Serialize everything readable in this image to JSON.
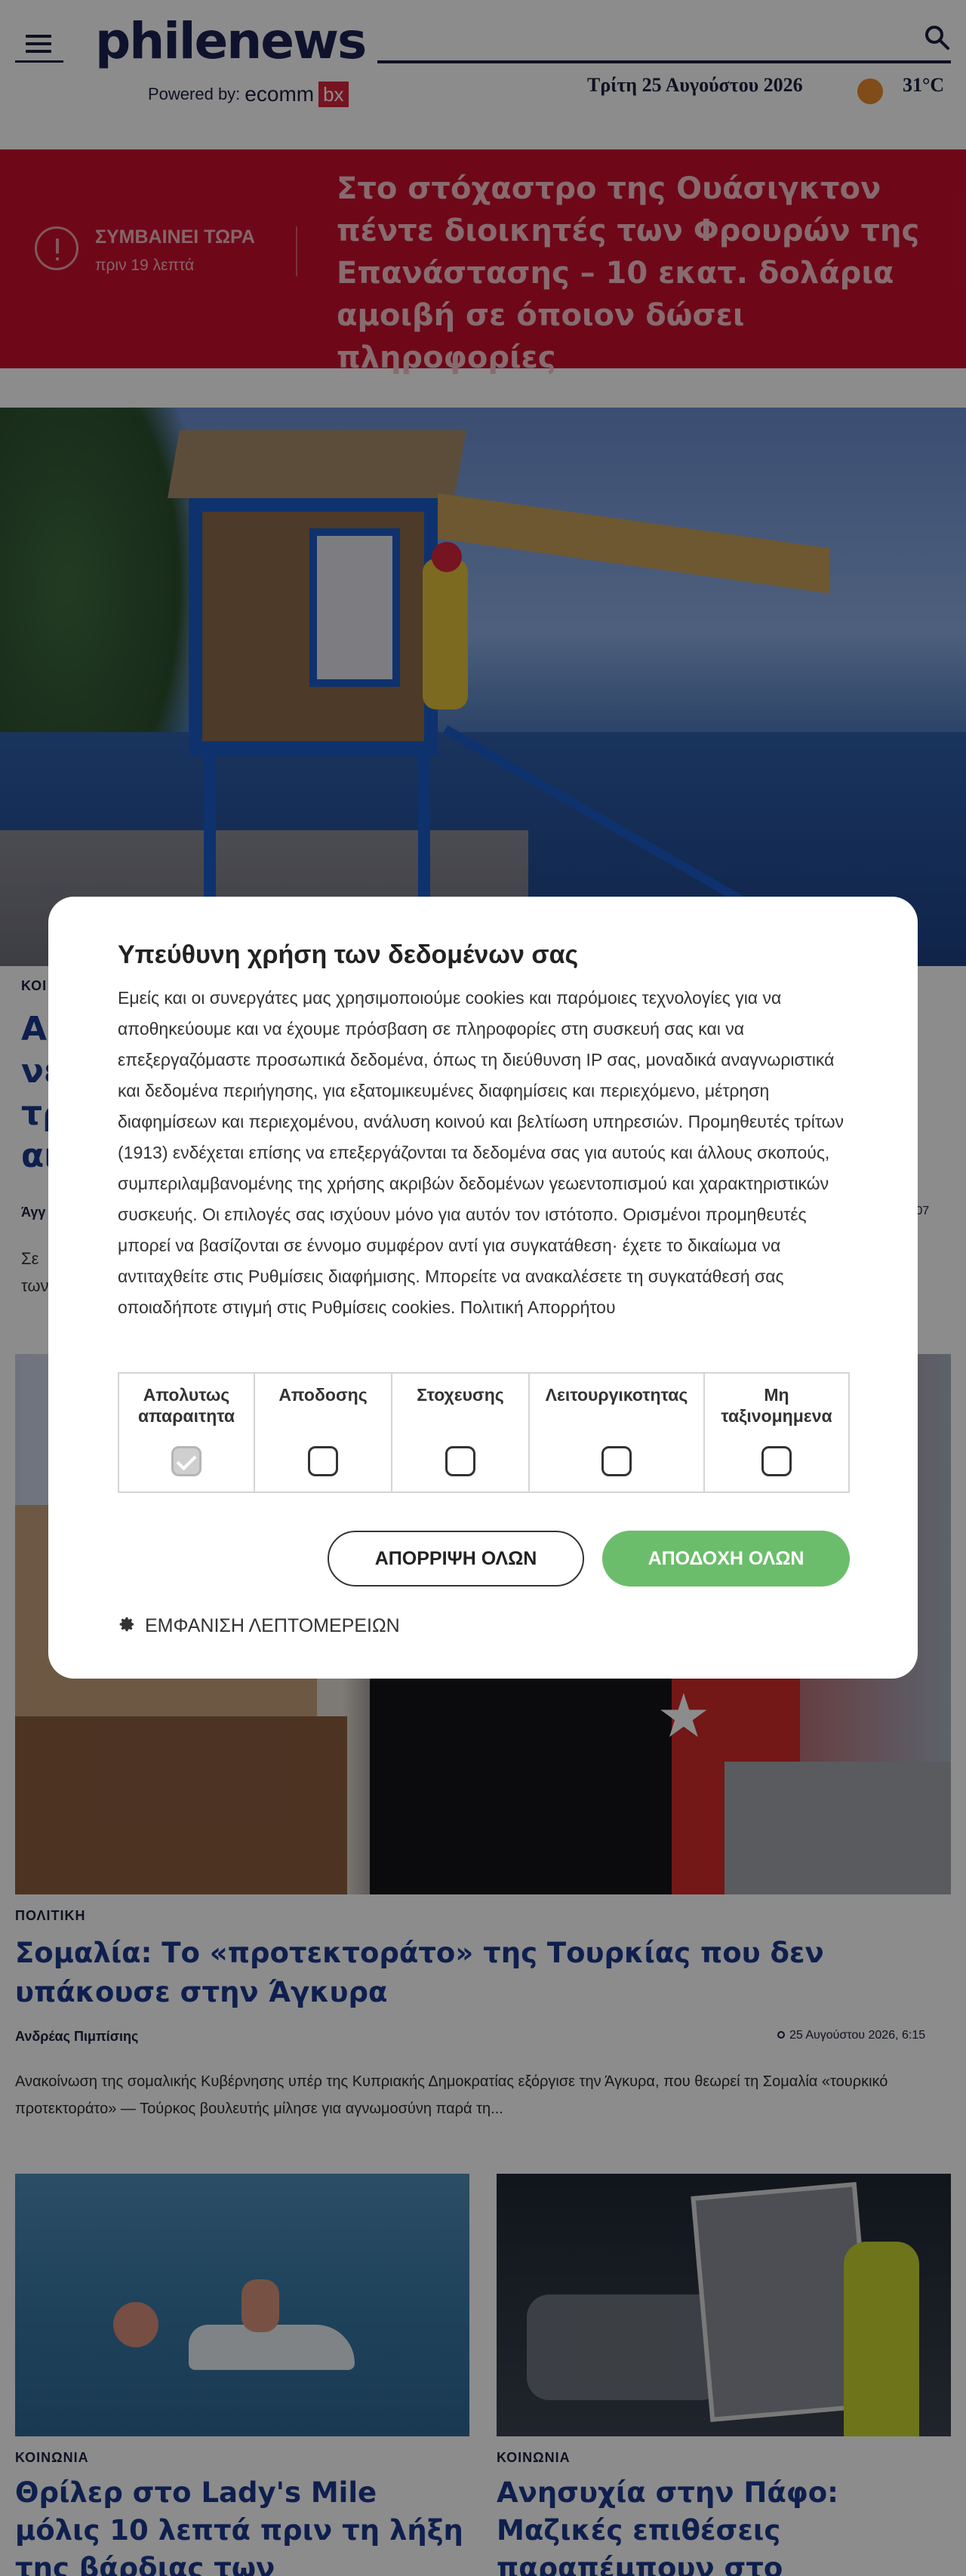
{
  "header": {
    "logo": "philenews",
    "powered_by": "Powered by:",
    "sponsor_main": "ecomm",
    "sponsor_box": "bx",
    "date": "Τρίτη 25 Αυγούστου 2026",
    "temperature": "31°C"
  },
  "breaking": {
    "label": "ΣΥΜΒΑΙΝΕΙ ΤΩΡΑ",
    "time": "πριν 19 λεπτά",
    "title": "Στο στόχαστρο της Ουάσιγκτον πέντε διοικητές των Φρουρών της Επανάστασης – 10 εκατ. δολάρια αμοιβή σε όποιον δώσει πληροφορίες"
  },
  "article1": {
    "category": "ΚΟΙ",
    "title": "Α\nνε\nτρ\nαι",
    "author": "Άγγ",
    "time": "6:07",
    "excerpt": "Σε \nτων"
  },
  "article2": {
    "category": "ΠΟΛΙΤΙΚΗ",
    "title": "Σομαλία: Το «προτεκτοράτο» της Τουρκίας που δεν υπάκουσε στην Άγκυρα",
    "author": "Ανδρέας Πιμπίσιης",
    "time": "25 Αυγούστου 2026, 6:15",
    "excerpt": "Ανακοίνωση της σομαλικής Κυβέρνησης υπέρ της Κυπριακής Δημοκρατίας εξόργισε την Άγκυρα, που θεωρεί τη Σομαλία «τουρκικό προτεκτοράτο» — Τούρκος βουλευτής μίλησε για αγνωμοσύνη παρά τη..."
  },
  "article3": {
    "category": "ΚΟΙΝΩΝΙΑ",
    "title": "Θρίλερ στο Lady's Mile μόλις 10 λεπτά πριν τη λήξη της βάρδιας των ναυαγοσωστών: Τρίχορο..."
  },
  "article4": {
    "category": "ΚΟΙΝΩΝΙΑ",
    "title": "Ανησυχία στην Πάφο: Μαζικές επιθέσεις παραπέμπουν στο φαινόμενο «smash and grab»"
  },
  "consent": {
    "title": "Υπεύθυνη χρήση των δεδομένων σας",
    "body": "Εμείς και οι συνεργάτες μας χρησιμοποιούμε cookies και παρόμοιες τεχνολογίες για να αποθηκεύουμε και να έχουμε πρόσβαση σε πληροφορίες στη συσκευή σας και να επεξεργαζόμαστε προσωπικά δεδομένα, όπως τη διεύθυνση IP σας, μοναδικά αναγνωριστικά και δεδομένα περιήγησης, για εξατομικευμένες διαφημίσεις και περιεχόμενο, μέτρηση διαφημίσεων και περιεχομένου, ανάλυση κοινού και βελτίωση υπηρεσιών. Προμηθευτές τρίτων (1913) ενδέχεται επίσης να επεξεργάζονται τα δεδομένα σας για αυτούς και άλλους σκοπούς, συμπεριλαμβανομένης της χρήσης ακριβών δεδομένων γεωεντοπισμού και χαρακτηριστικών συσκευής. Οι επιλογές σας ισχύουν μόνο για αυτόν τον ιστότοπο. Ορισμένοι προμηθευτές μπορεί να βασίζονται σε έννομο συμφέρον αντί για συγκατάθεση· έχετε το δικαίωμα να αντιταχθείτε στις Ρυθμίσεις διαφήμισης. Μπορείτε να ανακαλέσετε τη συγκατάθεσή σας οποιαδήποτε στιγμή στις Ρυθμίσεις cookies. Πολιτική Απορρήτου",
    "categories": [
      {
        "label": "Απολυτως απαραιτητα",
        "checked": true
      },
      {
        "label": "Αποδοσης",
        "checked": false
      },
      {
        "label": "Στοχευσης",
        "checked": false
      },
      {
        "label": "Λειτουργικοτητας",
        "checked": false
      },
      {
        "label": "Μη ταξινομημενα",
        "checked": false
      }
    ],
    "reject_label": "ΑΠΟΡΡΙΨΗ ΟΛΩΝ",
    "accept_label": "ΑΠΟΔΟΧΗ ΟΛΩΝ",
    "details_label": "ΕΜΦΑΝΙΣΗ ΛΕΠΤΟΜΕΡΕΙΩΝ"
  },
  "colors": {
    "breaking_bg": "#c8102e",
    "accept_green": "#6bbd6b",
    "brand_navy": "#1c2250",
    "headline_blue": "#1a3a8f"
  }
}
